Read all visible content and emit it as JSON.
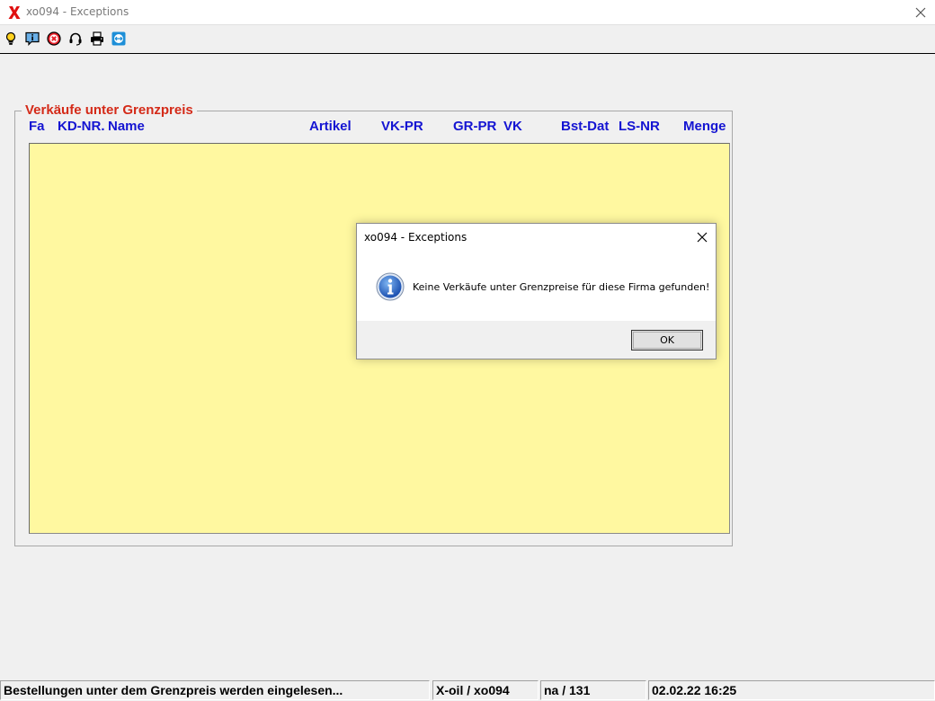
{
  "window": {
    "title": "xo094 - Exceptions",
    "logo_icon": "red-x-logo-icon",
    "close_icon": "close-icon"
  },
  "toolbar": {
    "buttons": [
      {
        "name": "lightbulb-icon",
        "tooltip": ""
      },
      {
        "name": "info-message-icon",
        "tooltip": ""
      },
      {
        "name": "cancel-icon",
        "tooltip": ""
      },
      {
        "name": "headset-icon",
        "tooltip": ""
      },
      {
        "name": "printer-icon",
        "tooltip": ""
      },
      {
        "name": "remote-support-icon",
        "tooltip": ""
      }
    ]
  },
  "group": {
    "title": "Verkäufe unter Grenzpreis",
    "columns": [
      "Fa",
      "KD-NR.",
      "Name",
      "Artikel",
      "VK-PR",
      "GR-PR",
      "VK",
      "Bst-Dat",
      "LS-NR",
      "Menge"
    ],
    "rows": []
  },
  "dialog": {
    "title": "xo094 - Exceptions",
    "message": "Keine Verkäufe unter Grenzpreise für diese Firma gefunden!",
    "ok_label": "OK",
    "icon": "info-icon"
  },
  "statusbar": {
    "message": "Bestellungen unter dem Grenzpreis werden eingelesen...",
    "app": "X-oil / xo094",
    "user": "na / 131",
    "datetime": "02.02.22 16:25"
  },
  "colors": {
    "window_bg": "#f0f0f0",
    "list_bg": "#fff8a0",
    "group_title": "#d42a18",
    "column_header": "#1414d2"
  }
}
